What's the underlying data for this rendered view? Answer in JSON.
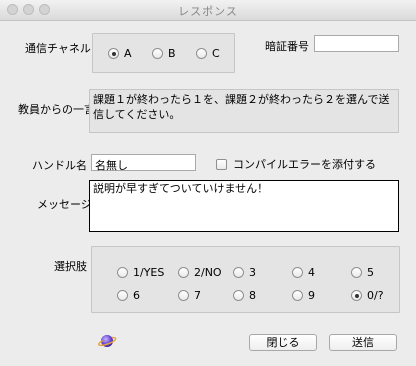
{
  "window": {
    "title": "レスポンス"
  },
  "channel": {
    "label": "通信チャネル",
    "options": [
      {
        "label": "A",
        "selected": true
      },
      {
        "label": "B",
        "selected": false
      },
      {
        "label": "C",
        "selected": false
      }
    ]
  },
  "pin": {
    "label": "暗証番号",
    "value": ""
  },
  "teacher_message": {
    "label": "教員からの一言",
    "text": "課題１が終わったら１を、課題２が終わったら２を選んで送信してください。"
  },
  "handle": {
    "label": "ハンドル名",
    "value": "名無し"
  },
  "attach_compile_error": {
    "label": "コンパイルエラーを添付する",
    "checked": false
  },
  "message": {
    "label": "メッセージ",
    "value": "説明が早すぎてついていけません！"
  },
  "choices": {
    "label": "選択肢",
    "options": [
      {
        "label": "1/YES",
        "selected": false
      },
      {
        "label": "2/NO",
        "selected": false
      },
      {
        "label": "3",
        "selected": false
      },
      {
        "label": "4",
        "selected": false
      },
      {
        "label": "5",
        "selected": false
      },
      {
        "label": "6",
        "selected": false
      },
      {
        "label": "7",
        "selected": false
      },
      {
        "label": "8",
        "selected": false
      },
      {
        "label": "9",
        "selected": false
      },
      {
        "label": "0/?",
        "selected": true
      }
    ]
  },
  "buttons": {
    "close": "閉じる",
    "send": "送信"
  },
  "icons": {
    "logo": "planet-icon"
  }
}
